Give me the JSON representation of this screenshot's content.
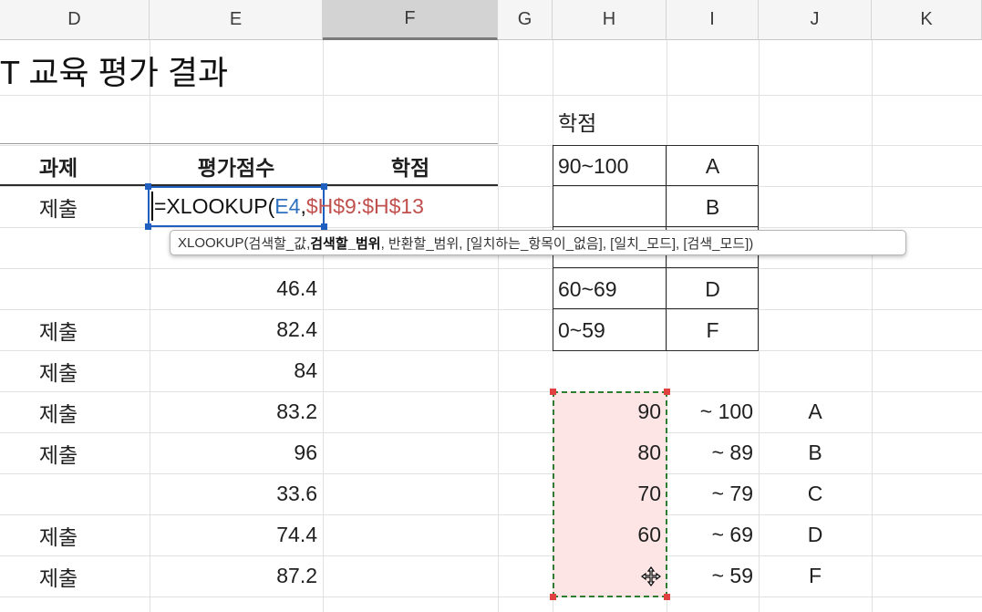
{
  "columns": [
    "D",
    "E",
    "F",
    "G",
    "H",
    "I",
    "J",
    "K"
  ],
  "title": "T 교육 평가 결과",
  "headers": {
    "d": "과제",
    "e": "평가점수",
    "f": "학점"
  },
  "grade_table_title": "학점",
  "grade_table": [
    {
      "range": "90~100",
      "grade": "A"
    },
    {
      "range": "",
      "grade": "B"
    },
    {
      "range": "",
      "grade": ""
    },
    {
      "range": "60~69",
      "grade": "D"
    },
    {
      "range": "0~59",
      "grade": "F"
    }
  ],
  "rows": [
    {
      "d": "제출",
      "e": ""
    },
    {
      "d": "",
      "e": ""
    },
    {
      "d": "",
      "e": "46.4"
    },
    {
      "d": "제출",
      "e": "82.4"
    },
    {
      "d": "제출",
      "e": "84"
    },
    {
      "d": "제출",
      "e": "83.2"
    },
    {
      "d": "제출",
      "e": "96"
    },
    {
      "d": "",
      "e": "33.6"
    },
    {
      "d": "제출",
      "e": "74.4"
    },
    {
      "d": "제출",
      "e": "87.2"
    }
  ],
  "lookup_table": [
    {
      "h": "90",
      "i": "~ 100",
      "j": "A"
    },
    {
      "h": "80",
      "i": "~ 89",
      "j": "B"
    },
    {
      "h": "70",
      "i": "~ 79",
      "j": "C"
    },
    {
      "h": "60",
      "i": "~ 69",
      "j": "D"
    },
    {
      "h": "",
      "i": "~ 59",
      "j": "F"
    }
  ],
  "edit_formula": {
    "prefix": "=XLOOKUP(",
    "ref1": "E4",
    "sep": ",",
    "ref2": "$H$9:$H$13"
  },
  "tooltip": {
    "fn": "XLOOKUP(",
    "arg1": "검색할_값, ",
    "arg2": "검색할_범위",
    "rest": ", 반환할_범위, [일치하는_항목이_없음], [일치_모드], [검색_모드])"
  },
  "colors": {
    "ref_blue": "#2f6fbf",
    "ref_red": "#c0504d",
    "copy_border": "#2e7d32",
    "highlight": "#fde5e5"
  }
}
